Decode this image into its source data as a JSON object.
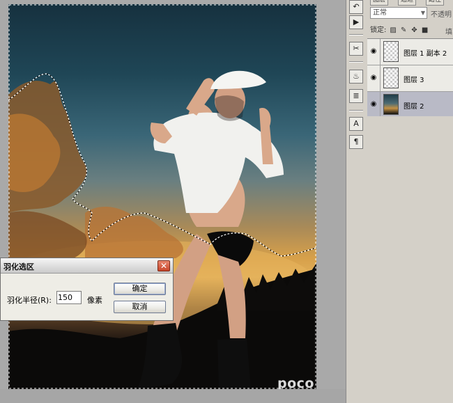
{
  "dialog": {
    "title": "羽化选区",
    "radius_label": "羽化半径(R):",
    "radius_value": "150",
    "unit": "像素",
    "ok_label": "确定",
    "cancel_label": "取消",
    "close_glyph": "✕"
  },
  "panel": {
    "tabs": [
      "图层",
      "通道",
      "路径"
    ],
    "blend_mode": "正常",
    "opacity_label": "不透明",
    "lock_label": "锁定:",
    "fill_label": "填",
    "layers": [
      {
        "name": "图层 1 副本 2",
        "selected": false
      },
      {
        "name": "图层 3",
        "selected": false
      },
      {
        "name": "图层 2",
        "selected": true
      }
    ]
  },
  "toolstrip": {
    "icons": [
      "history-brush-icon",
      "action-play-icon",
      "brush-tool-icon",
      "clone-stamp-icon",
      "tool-preset-icon",
      "character-icon",
      "paragraph-icon"
    ],
    "glyphs": [
      "↶",
      "▶",
      "✂",
      "♨",
      "≣",
      "A",
      "¶"
    ]
  },
  "watermark": "poco",
  "colors": {
    "selected_layer": "#b9bac6",
    "close_button": "#c8452a",
    "panel_bg": "#d4d0c8"
  }
}
